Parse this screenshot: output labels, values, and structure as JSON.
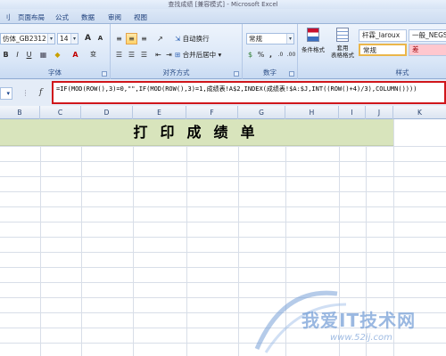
{
  "window": {
    "title": "查找成绩 [兼容模式] - Microsoft Excel"
  },
  "tabs": [
    {
      "label": "刂"
    },
    {
      "label": "页面布局"
    },
    {
      "label": "公式"
    },
    {
      "label": "数据"
    },
    {
      "label": "审阅"
    },
    {
      "label": "视图"
    }
  ],
  "ribbon": {
    "font": {
      "name": "仿体_GB2312",
      "size": "14",
      "grow_label": "A",
      "shrink_label": "A",
      "bold": "B",
      "italic": "I",
      "underline": "U",
      "group_label": "字体",
      "font_color_label": "A",
      "phonetic_label": "变"
    },
    "alignment": {
      "wrap_label": "自动换行",
      "merge_label": "合并后居中",
      "group_label": "对齐方式"
    },
    "number": {
      "format": "常规",
      "percent": "%",
      "comma": ",",
      "decimal_inc": ".0",
      "decimal_dec": ".00",
      "group_label": "数字"
    },
    "styles": {
      "conditional_label": "条件格式",
      "table_label": "套用\n表格格式",
      "style_1": "杆霖_laroux",
      "style_2": "一般_NEGS",
      "style_normal": "常规",
      "style_bad": "差",
      "group_label": "样式"
    }
  },
  "formula_bar": {
    "name_box": "",
    "fx": "f",
    "formula_line1": "=IF(MOD(ROW(),3)=0,\"\",IF(MOD(ROW(),3)=1,成绩表!A$2,INDEX(成绩表!$A:$J,INT((ROW()+4)/3),COLUMN())))",
    "formula_line2": ""
  },
  "columns": [
    "B",
    "C",
    "D",
    "E",
    "F",
    "G",
    "H",
    "I",
    "J",
    "K"
  ],
  "sheet": {
    "banner": "打印成绩单"
  },
  "watermark": {
    "text": "我爱IT技术网",
    "url": "www.52ij.com"
  },
  "colors": {
    "banner_bg": "#d8e4bc",
    "formula_highlight": "#d0161b",
    "active_button": "#ffd36b"
  }
}
